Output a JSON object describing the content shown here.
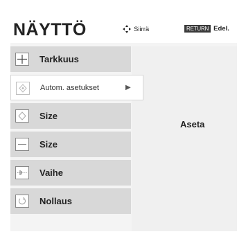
{
  "header": {
    "title": "NÄYTTÖ",
    "move_hint": "Siirrä",
    "return_key": "RETURN",
    "return_hint": "Edel."
  },
  "menu": {
    "items": [
      {
        "label": "Tarkkuus",
        "icon": "plus-crosshair-icon"
      },
      {
        "label": "Autom. asetukset",
        "icon": "auto-setup-icon",
        "arrow": "▶",
        "selected": true
      },
      {
        "label": "Size",
        "icon": "position-icon"
      },
      {
        "label": "Size",
        "icon": "size-icon"
      },
      {
        "label": "Vaihe",
        "icon": "phase-icon"
      },
      {
        "label": "Nollaus",
        "icon": "reset-icon"
      }
    ]
  },
  "panel": {
    "value": "Aseta"
  },
  "colors": {
    "menu_item_bg": "#d8d8d8",
    "selected_bg": "#ffffff",
    "panel_bg": "#f0f0f0",
    "return_key_bg": "#3a3a3a"
  }
}
